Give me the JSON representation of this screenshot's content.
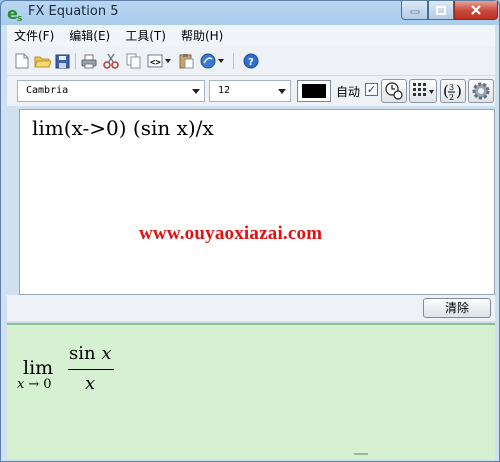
{
  "window": {
    "title": "FX Equation 5"
  },
  "menu": [
    "文件(F)",
    "编辑(E)",
    "工具(T)",
    "帮助(H)"
  ],
  "toolbar": {
    "icons": [
      "new-file-icon",
      "open-folder-icon",
      "save-icon",
      "print-icon",
      "cut-icon",
      "copy-icon",
      "code-dropdown-icon",
      "paste-icon",
      "web-dropdown-icon",
      "help-icon"
    ]
  },
  "format": {
    "font": "Cambria",
    "size": "12",
    "color": "#000000",
    "auto_label": "自动",
    "auto_checked": true
  },
  "editor": {
    "text": "lim(x->0) (sin x)/x"
  },
  "watermark": "www.ouyaoxiazai.com",
  "actions": {
    "clear_label": "清除"
  },
  "preview": {
    "lim": "lim",
    "sub_var": "x",
    "sub_arrow": "→",
    "sub_limit": "0",
    "num_fn": "sin",
    "num_var": "x",
    "den": "x",
    "bg_color": "#d6f1d2"
  }
}
